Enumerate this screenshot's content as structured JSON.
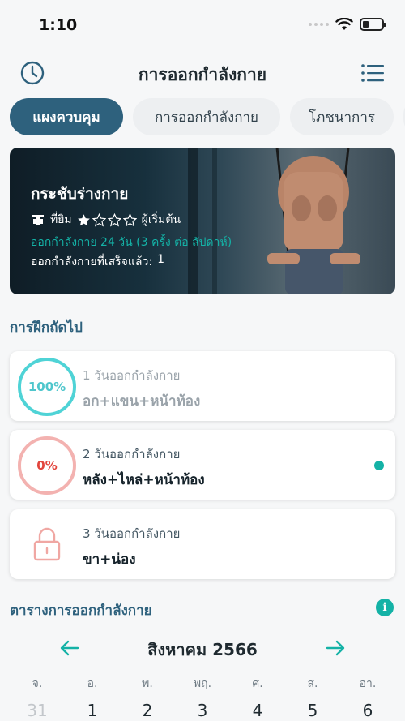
{
  "status": {
    "time": "1:10"
  },
  "header": {
    "title": "การออกกำลังกาย",
    "history_icon": "clock-icon",
    "menu_icon": "list-icon"
  },
  "tabs": [
    {
      "label": "แผงควบคุม",
      "active": true
    },
    {
      "label": "การออกกำลังกาย",
      "active": false
    },
    {
      "label": "โภชนาการ",
      "active": false
    },
    {
      "label": "",
      "active": false
    }
  ],
  "hero": {
    "title": "กระชับร่างกาย",
    "location": "ที่ยิม",
    "difficulty_stars": 1,
    "difficulty_max": 4,
    "level": "ผู้เริ่มต้น",
    "schedule": "ออกกำลังกาย 24 วัน (3 ครั้ง ต่อ สัปดาห์)",
    "completed_label": "ออกกำลังกายที่เสร็จแล้ว:",
    "completed_count": "1"
  },
  "next_section": {
    "title": "การฝึกถัดไป"
  },
  "workouts": [
    {
      "progress": "100%",
      "day": "1 วันออกกำลังกาย",
      "name": "อก+แขน+หน้าท้อง",
      "state": "done"
    },
    {
      "progress": "0%",
      "day": "2 วันออกกำลังกาย",
      "name": "หลัง+ไหล่+หน้าท้อง",
      "state": "current"
    },
    {
      "progress": "",
      "day": "3 วันออกกำลังกาย",
      "name": "ขา+น่อง",
      "state": "locked"
    }
  ],
  "schedule_section": {
    "title": "ตารางการออกกำลังกาย",
    "info_label": "i"
  },
  "calendar": {
    "month": "สิงหาคม 2566",
    "weekdays": [
      "จ.",
      "อ.",
      "พ.",
      "พฤ.",
      "ศ.",
      "ส.",
      "อา."
    ],
    "dates": [
      "31",
      "1",
      "2",
      "3",
      "4",
      "5",
      "6"
    ]
  },
  "colors": {
    "primary": "#2e617d",
    "accent": "#14b2a6",
    "done_ring": "#4fd3d6",
    "zero_ring": "#f3b2b0",
    "zero_text": "#e2453d"
  }
}
